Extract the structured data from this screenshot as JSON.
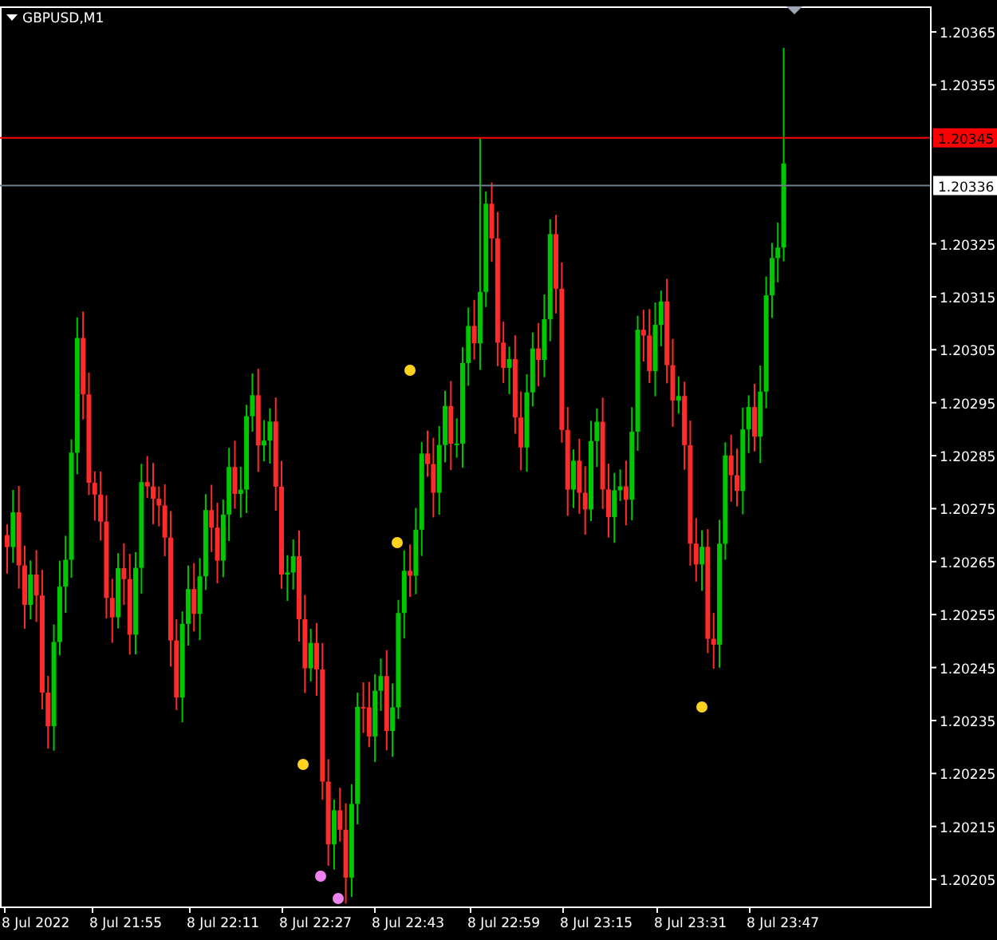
{
  "chart_window": {
    "title": "GBPUSD,M1"
  },
  "price_axis": {
    "labels": [
      "1.20365",
      "1.20355",
      "1.20325",
      "1.20315",
      "1.20305",
      "1.20295",
      "1.20285",
      "1.20275",
      "1.20265",
      "1.20255",
      "1.20245",
      "1.20235",
      "1.20225",
      "1.20215",
      "1.20205"
    ]
  },
  "ask_line": {
    "price": "1.20345"
  },
  "bid_line": {
    "price": "1.20336"
  },
  "time_axis": {
    "labels": [
      "8 Jul 2022",
      "8 Jul 21:55",
      "8 Jul 22:11",
      "8 Jul 22:27",
      "8 Jul 22:43",
      "8 Jul 22:59",
      "8 Jul 23:15",
      "8 Jul 23:31",
      "8 Jul 23:47"
    ]
  }
}
